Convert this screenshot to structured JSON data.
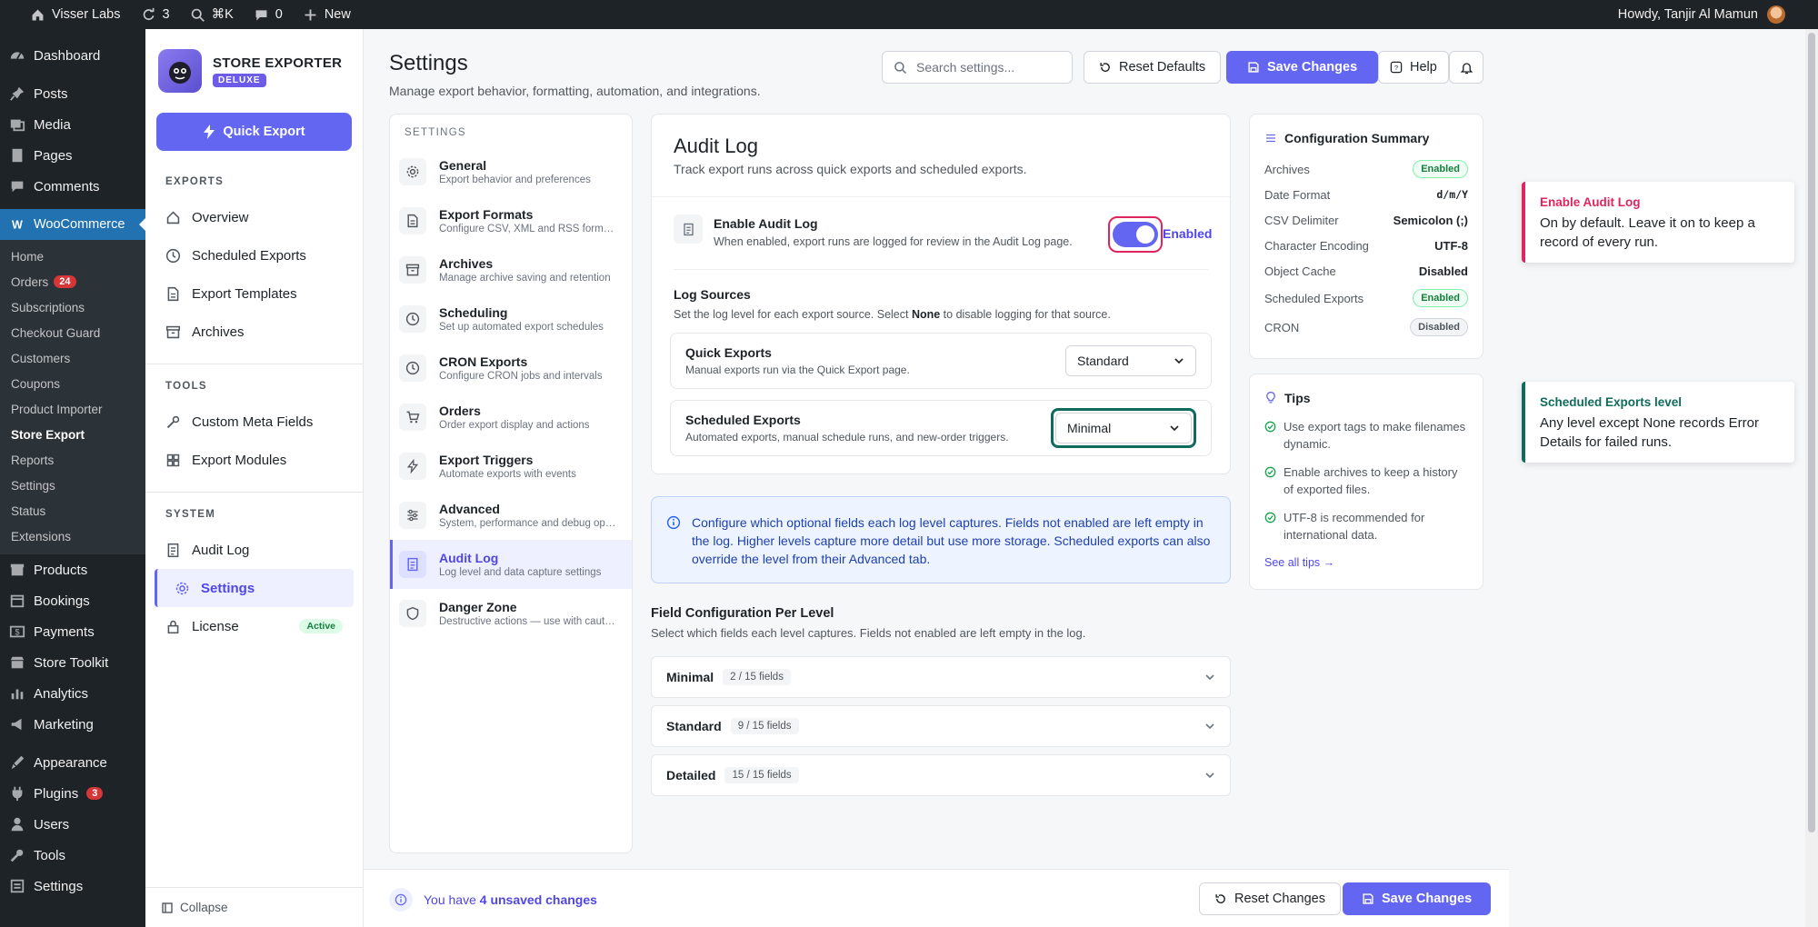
{
  "adminbar": {
    "site": "Visser Labs",
    "updates": "3",
    "search_shortcut": "⌘K",
    "comments": "0",
    "new": "New",
    "howdy": "Howdy, Tanjir Al Mamun"
  },
  "wp_menu": {
    "top": [
      {
        "label": "Dashboard",
        "icon": "dashboard-icon"
      }
    ],
    "group2": [
      {
        "label": "Posts"
      },
      {
        "label": "Media"
      },
      {
        "label": "Pages"
      },
      {
        "label": "Comments"
      }
    ],
    "woocommerce": "WooCommerce",
    "woo_sub": [
      {
        "label": "Home"
      },
      {
        "label": "Orders",
        "badge": "24"
      },
      {
        "label": "Subscriptions"
      },
      {
        "label": "Checkout Guard"
      },
      {
        "label": "Customers"
      },
      {
        "label": "Coupons"
      },
      {
        "label": "Product Importer"
      },
      {
        "label": "Store Export"
      },
      {
        "label": "Reports"
      },
      {
        "label": "Settings"
      },
      {
        "label": "Status"
      },
      {
        "label": "Extensions"
      }
    ],
    "group3": [
      {
        "label": "Products"
      },
      {
        "label": "Bookings"
      },
      {
        "label": "Payments"
      },
      {
        "label": "Store Toolkit"
      },
      {
        "label": "Analytics"
      },
      {
        "label": "Marketing"
      }
    ],
    "group4": [
      {
        "label": "Appearance"
      },
      {
        "label": "Plugins",
        "badge": "3"
      },
      {
        "label": "Users"
      },
      {
        "label": "Tools"
      },
      {
        "label": "Settings"
      }
    ]
  },
  "plugin": {
    "name": "STORE EXPORTER",
    "edition": "DELUXE",
    "quick_export": "Quick Export",
    "sections": [
      {
        "title": "EXPORTS",
        "items": [
          "Overview",
          "Scheduled Exports",
          "Export Templates",
          "Archives"
        ]
      },
      {
        "title": "TOOLS",
        "items": [
          "Custom Meta Fields",
          "Export Modules"
        ]
      },
      {
        "title": "SYSTEM",
        "items": [
          "Audit Log",
          "Settings",
          "License"
        ]
      }
    ],
    "license_badge": "Active",
    "collapse": "Collapse"
  },
  "header": {
    "title": "Settings",
    "subtitle": "Manage export behavior, formatting, automation, and integrations.",
    "search_placeholder": "Search settings...",
    "reset_defaults": "Reset Defaults",
    "save": "Save Changes",
    "help": "Help"
  },
  "settings_nav": {
    "heading": "SETTINGS",
    "items": [
      {
        "title": "General",
        "desc": "Export behavior and preferences"
      },
      {
        "title": "Export Formats",
        "desc": "Configure CSV, XML and RSS formats"
      },
      {
        "title": "Archives",
        "desc": "Manage archive saving and retention"
      },
      {
        "title": "Scheduling",
        "desc": "Set up automated export schedules"
      },
      {
        "title": "CRON Exports",
        "desc": "Configure CRON jobs and intervals"
      },
      {
        "title": "Orders",
        "desc": "Order export display and actions"
      },
      {
        "title": "Export Triggers",
        "desc": "Automate exports with events"
      },
      {
        "title": "Advanced",
        "desc": "System, performance and debug options"
      },
      {
        "title": "Audit Log",
        "desc": "Log level and data capture settings"
      },
      {
        "title": "Danger Zone",
        "desc": "Destructive actions — use with caution"
      }
    ]
  },
  "audit": {
    "title": "Audit Log",
    "subtitle": "Track export runs across quick exports and scheduled exports.",
    "enable_title": "Enable Audit Log",
    "enable_desc": "When enabled, export runs are logged for review in the Audit Log page.",
    "enable_state": "Enabled",
    "sources_title": "Log Sources",
    "sources_desc_a": "Set the log level for each export source. Select ",
    "sources_desc_b": "None",
    "sources_desc_c": " to disable logging for that source.",
    "sources": [
      {
        "title": "Quick Exports",
        "desc": "Manual exports run via the Quick Export page.",
        "level": "Standard"
      },
      {
        "title": "Scheduled Exports",
        "desc": "Automated exports, manual schedule runs, and new-order triggers.",
        "level": "Minimal"
      }
    ]
  },
  "info": "Configure which optional fields each log level captures. Fields not enabled are left empty in the log. Higher levels capture more detail but use more storage. Scheduled exports can also override the level from their Advanced tab.",
  "field_config": {
    "title": "Field Configuration Per Level",
    "desc": "Select which fields each level captures. Fields not enabled are left empty in the log.",
    "levels": [
      {
        "name": "Minimal",
        "count": "2 / 15 fields"
      },
      {
        "name": "Standard",
        "count": "9 / 15 fields"
      },
      {
        "name": "Detailed",
        "count": "15 / 15 fields"
      }
    ]
  },
  "summary": {
    "title": "Configuration Summary",
    "rows": [
      {
        "label": "Archives",
        "value": "Enabled",
        "kind": "badge-on"
      },
      {
        "label": "Date Format",
        "value": "d/m/Y",
        "kind": "mono"
      },
      {
        "label": "CSV Delimiter",
        "value": "Semicolon (;)",
        "kind": "text"
      },
      {
        "label": "Character Encoding",
        "value": "UTF-8",
        "kind": "text"
      },
      {
        "label": "Object Cache",
        "value": "Disabled",
        "kind": "text"
      },
      {
        "label": "Scheduled Exports",
        "value": "Enabled",
        "kind": "badge-on"
      },
      {
        "label": "CRON",
        "value": "Disabled",
        "kind": "badge-off"
      }
    ]
  },
  "tips": {
    "title": "Tips",
    "items": [
      "Use export tags to make filenames dynamic.",
      "Enable archives to keep a history of exported files.",
      "UTF-8 is recommended for international data."
    ],
    "link": "See all tips →"
  },
  "annotations": [
    {
      "title": "Enable Audit Log",
      "body": "On by default. Leave it on to keep a record of every run.",
      "color": "#e0245e"
    },
    {
      "title": "Scheduled Exports level",
      "body": "Any level except None records Error Details for failed runs.",
      "color": "#0f6b5c"
    }
  ],
  "footer": {
    "msg_a": "You have ",
    "msg_b": "4 unsaved changes",
    "reset": "Reset Changes",
    "save": "Save Changes"
  },
  "colors": {
    "accent": "#6366f1",
    "wp_dark": "#1d2327",
    "wp_blue": "#2271b1",
    "success": "#15803d"
  }
}
